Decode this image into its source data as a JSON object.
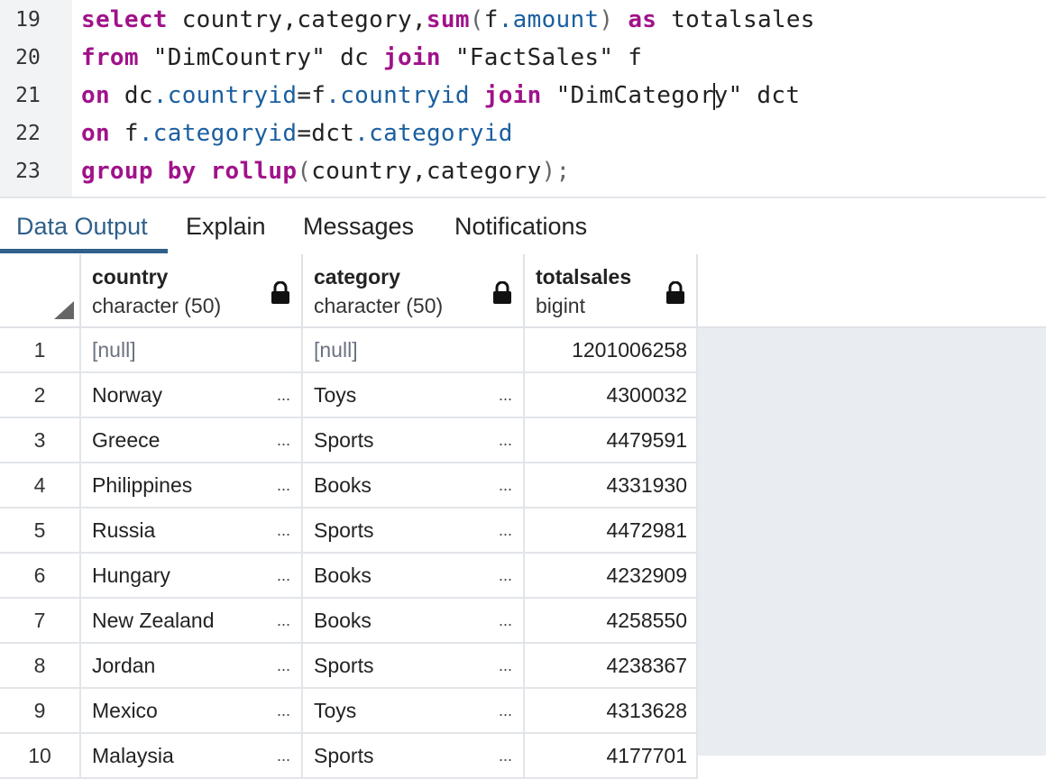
{
  "editor": {
    "lines": [
      {
        "num": "19",
        "tokens": [
          {
            "t": "select",
            "c": "kw"
          },
          {
            "t": " country,category,",
            "c": ""
          },
          {
            "t": "sum",
            "c": "kw"
          },
          {
            "t": "(",
            "c": "pn"
          },
          {
            "t": "f",
            "c": ""
          },
          {
            "t": ".amount",
            "c": "fld"
          },
          {
            "t": ")",
            "c": "pn"
          },
          {
            "t": " ",
            "c": ""
          },
          {
            "t": "as",
            "c": "kw"
          },
          {
            "t": " totalsales",
            "c": ""
          }
        ]
      },
      {
        "num": "20",
        "tokens": [
          {
            "t": "from",
            "c": "kw"
          },
          {
            "t": " \"DimCountry\" dc ",
            "c": ""
          },
          {
            "t": "join",
            "c": "kw"
          },
          {
            "t": " \"FactSales\" f",
            "c": ""
          }
        ]
      },
      {
        "num": "21",
        "tokens": [
          {
            "t": "on",
            "c": "kw"
          },
          {
            "t": " dc",
            "c": ""
          },
          {
            "t": ".countryid",
            "c": "fld"
          },
          {
            "t": "=f",
            "c": ""
          },
          {
            "t": ".countryid",
            "c": "fld"
          },
          {
            "t": " ",
            "c": ""
          },
          {
            "t": "join",
            "c": "kw"
          },
          {
            "t": " \"DimCategor",
            "c": ""
          },
          {
            "t": "",
            "c": "caret"
          },
          {
            "t": "y\" dct",
            "c": ""
          }
        ]
      },
      {
        "num": "22",
        "tokens": [
          {
            "t": "on",
            "c": "kw"
          },
          {
            "t": " f",
            "c": ""
          },
          {
            "t": ".categoryid",
            "c": "fld"
          },
          {
            "t": "=dct",
            "c": ""
          },
          {
            "t": ".categoryid",
            "c": "fld"
          }
        ]
      },
      {
        "num": "23",
        "tokens": [
          {
            "t": "group by rollup",
            "c": "kw"
          },
          {
            "t": "(",
            "c": "pn"
          },
          {
            "t": "country,category",
            "c": ""
          },
          {
            "t": ");",
            "c": "pn"
          }
        ]
      }
    ]
  },
  "tabs": [
    "Data Output",
    "Explain",
    "Messages",
    "Notifications"
  ],
  "grid": {
    "columns": [
      {
        "name": "country",
        "type": "character (50)"
      },
      {
        "name": "category",
        "type": "character (50)"
      },
      {
        "name": "totalsales",
        "type": "bigint"
      }
    ],
    "ellipsis": "...",
    "rows": [
      {
        "n": "1",
        "country": "[null]",
        "category": "[null]",
        "totalsales": "1201006258"
      },
      {
        "n": "2",
        "country": "Norway",
        "category": "Toys",
        "totalsales": "4300032"
      },
      {
        "n": "3",
        "country": "Greece",
        "category": "Sports",
        "totalsales": "4479591"
      },
      {
        "n": "4",
        "country": "Philippines",
        "category": "Books",
        "totalsales": "4331930"
      },
      {
        "n": "5",
        "country": "Russia",
        "category": "Sports",
        "totalsales": "4472981"
      },
      {
        "n": "6",
        "country": "Hungary",
        "category": "Books",
        "totalsales": "4232909"
      },
      {
        "n": "7",
        "country": "New Zealand",
        "category": "Books",
        "totalsales": "4258550"
      },
      {
        "n": "8",
        "country": "Jordan",
        "category": "Sports",
        "totalsales": "4238367"
      },
      {
        "n": "9",
        "country": "Mexico",
        "category": "Toys",
        "totalsales": "4313628"
      },
      {
        "n": "10",
        "country": "Malaysia",
        "category": "Sports",
        "totalsales": "4177701"
      }
    ]
  }
}
